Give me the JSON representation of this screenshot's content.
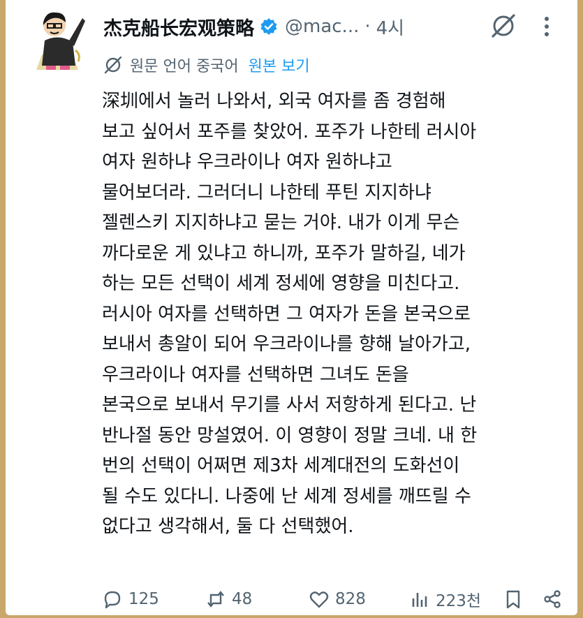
{
  "post": {
    "author_name": "杰克船长宏观策略",
    "handle": "@mac...",
    "separator": "·",
    "time": "4시",
    "translation_note": "원문 언어 중국어",
    "view_original_label": "원본 보기",
    "body_lines": [
      "深圳에서 놀러 나와서, 외국 여자를 좀 경험해",
      "보고 싶어서 포주를 찾았어. 포주가 나한테 러시아",
      "여자 원하냐 우크라이나 여자 원하냐고",
      "물어보더라. 그러더니 나한테 푸틴 지지하냐",
      "젤렌스키 지지하냐고 묻는 거야. 내가 이게 무슨",
      "까다로운 게 있냐고 하니까, 포주가 말하길, 네가",
      "하는 모든 선택이 세계 정세에 영향을 미친다고.",
      "러시아 여자를 선택하면 그 여자가 돈을 본국으로",
      "보내서 총알이 되어 우크라이나를 향해 날아가고,",
      "우크라이나 여자를 선택하면 그녀도 돈을",
      "본국으로 보내서 무기를 사서 저항하게 된다고. 난",
      "반나절 동안 망설였어. 이 영향이 정말 크네. 내 한",
      "번의 선택이 어쩌면 제3차 세계대전의 도화선이",
      "될 수도 있다니. 나중에 난 세계 정세를 깨뜨릴 수",
      "없다고 생각해서, 둘 다 선택했어."
    ]
  },
  "actions": {
    "replies": "125",
    "reposts": "48",
    "likes": "828",
    "views": "223천"
  },
  "icons": {
    "avatar": "cartoon-avatar",
    "verified": "verified-badge-icon",
    "grok": "grok-icon",
    "more": "more-vertical-icon",
    "translate": "translate-icon",
    "reply": "reply-icon",
    "repost": "repost-icon",
    "like": "heart-icon",
    "views": "views-icon",
    "bookmark": "bookmark-icon",
    "share": "share-icon"
  },
  "colors": {
    "accent": "#1d9bf0",
    "text": "#0f1419",
    "muted": "#536471",
    "frame": "#c9a66a"
  }
}
